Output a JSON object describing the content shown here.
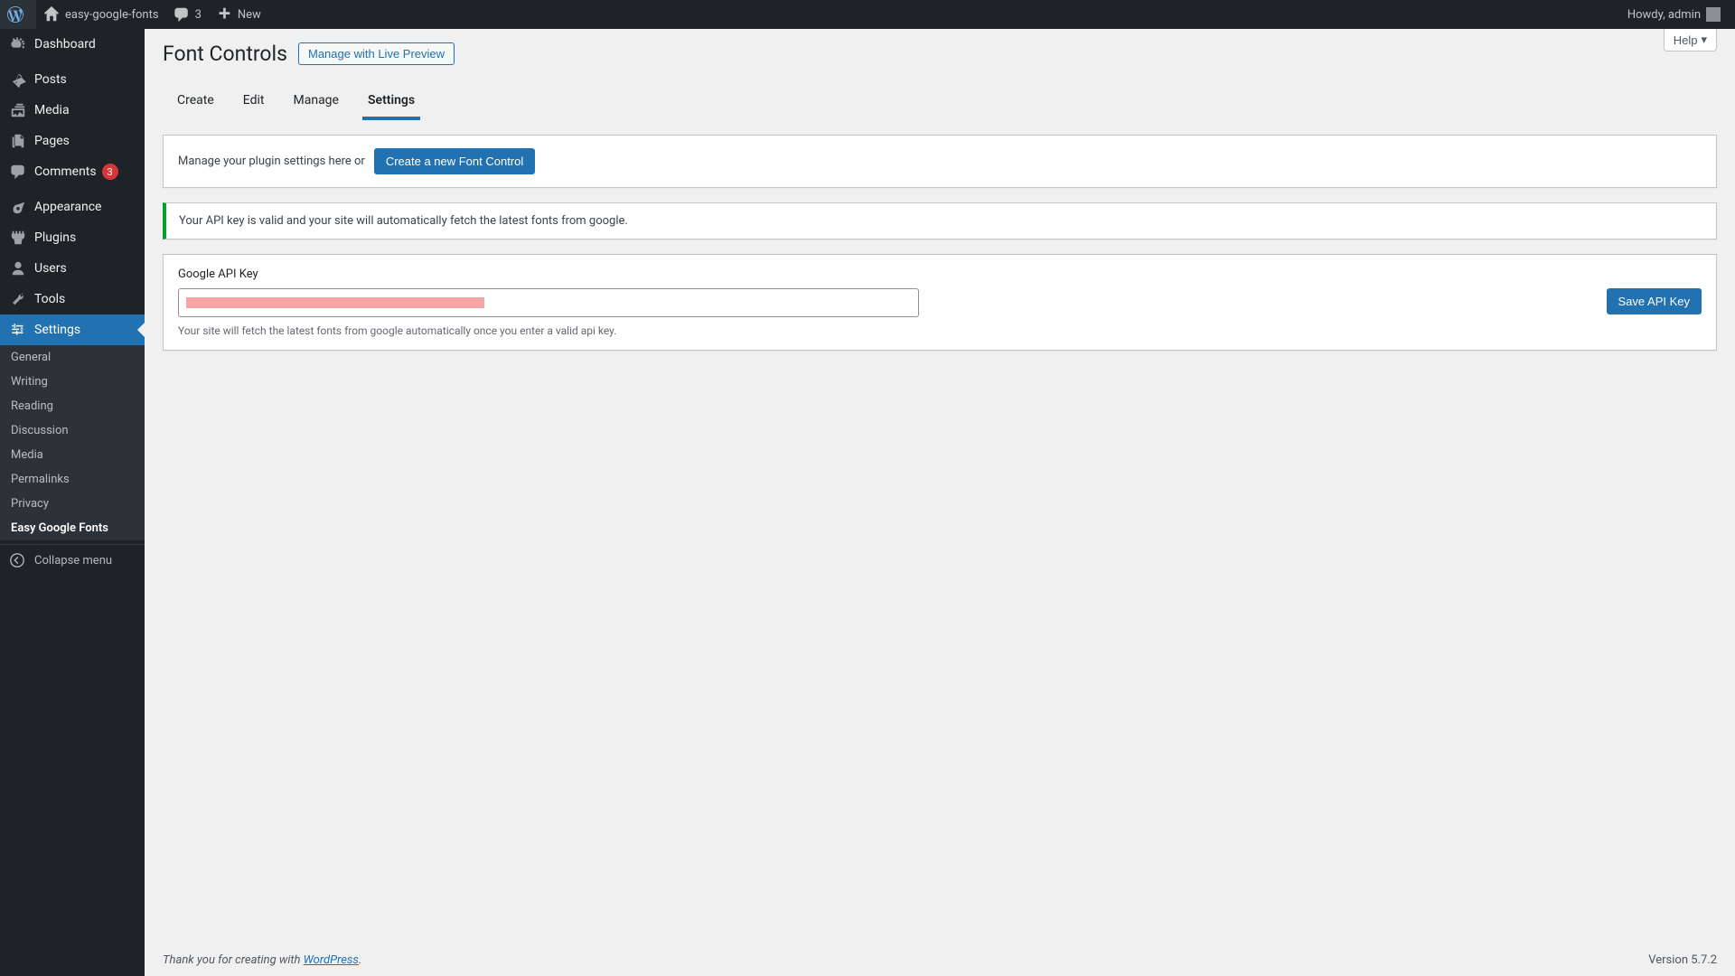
{
  "adminbar": {
    "site_name": "easy-google-fonts",
    "comment_count": "3",
    "new_label": "New",
    "howdy": "Howdy, admin"
  },
  "sidebar": {
    "dashboard": "Dashboard",
    "posts": "Posts",
    "media": "Media",
    "pages": "Pages",
    "comments": "Comments",
    "comments_badge": "3",
    "appearance": "Appearance",
    "plugins": "Plugins",
    "users": "Users",
    "tools": "Tools",
    "settings": "Settings",
    "sub": {
      "general": "General",
      "writing": "Writing",
      "reading": "Reading",
      "discussion": "Discussion",
      "media": "Media",
      "permalinks": "Permalinks",
      "privacy": "Privacy",
      "egf": "Easy Google Fonts"
    },
    "collapse": "Collapse menu"
  },
  "page": {
    "help_label": "Help",
    "title": "Font Controls",
    "action": "Manage with Live Preview",
    "tabs": {
      "create": "Create",
      "edit": "Edit",
      "manage": "Manage",
      "settings": "Settings"
    },
    "intro_text": "Manage your plugin settings here or",
    "create_btn": "Create a new Font Control",
    "notice": "Your API key is valid and your site will automatically fetch the latest fonts from google.",
    "api_label": "Google API Key",
    "api_help": "Your site will fetch the latest fonts from google automatically once you enter a valid api key.",
    "save_btn": "Save API Key"
  },
  "footer": {
    "thanks_prefix": "Thank you for creating with ",
    "wp_link": "WordPress",
    "thanks_suffix": ".",
    "version": "Version 5.7.2"
  }
}
